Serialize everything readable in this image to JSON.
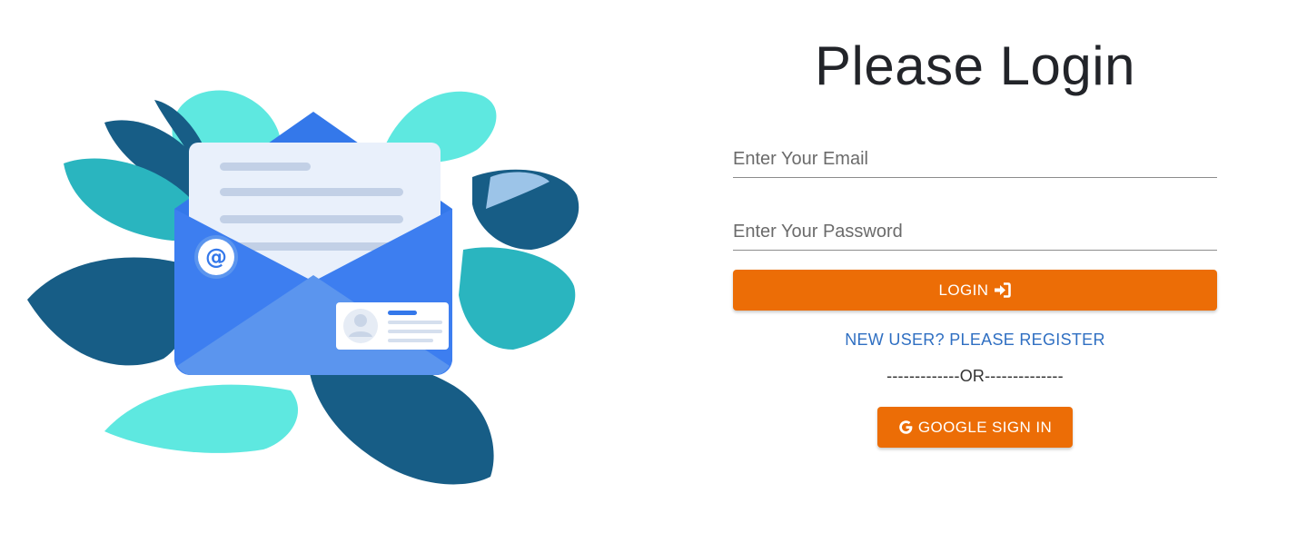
{
  "login": {
    "title": "Please Login",
    "email_placeholder": "Enter Your Email",
    "password_placeholder": "Enter Your Password",
    "login_label": "LOGIN",
    "login_icon": "sign-in-icon",
    "register_link": "NEW USER? PLEASE REGISTER",
    "divider": "-------------OR--------------",
    "google_label": "GOOGLE SIGN IN",
    "google_icon": "google-icon"
  },
  "illustration": {
    "subject": "envelope-with-letter-and-leaves",
    "badge_symbol": "@"
  },
  "colors": {
    "accent": "#ec6d06",
    "link": "#2f6fc2",
    "title": "#222429",
    "leaf_dark": "#175d86",
    "leaf_teal": "#2ab5bf",
    "leaf_light": "#5ee8e0",
    "envelope_blue": "#3d7ef0"
  }
}
